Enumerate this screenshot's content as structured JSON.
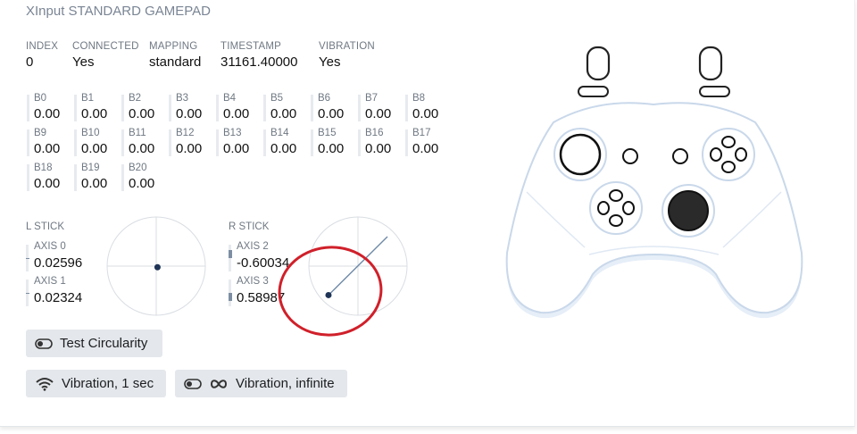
{
  "title": "XInput STANDARD GAMEPAD",
  "info": [
    {
      "label": "INDEX",
      "value": "0"
    },
    {
      "label": "CONNECTED",
      "value": "Yes"
    },
    {
      "label": "MAPPING",
      "value": "standard"
    },
    {
      "label": "TIMESTAMP",
      "value": "31161.40000"
    },
    {
      "label": "VIBRATION",
      "value": "Yes"
    }
  ],
  "buttons": [
    {
      "label": "B0",
      "value": "0.00"
    },
    {
      "label": "B1",
      "value": "0.00"
    },
    {
      "label": "B2",
      "value": "0.00"
    },
    {
      "label": "B3",
      "value": "0.00"
    },
    {
      "label": "B4",
      "value": "0.00"
    },
    {
      "label": "B5",
      "value": "0.00"
    },
    {
      "label": "B6",
      "value": "0.00"
    },
    {
      "label": "B7",
      "value": "0.00"
    },
    {
      "label": "B8",
      "value": "0.00"
    },
    {
      "label": "B9",
      "value": "0.00"
    },
    {
      "label": "B10",
      "value": "0.00"
    },
    {
      "label": "B11",
      "value": "0.00"
    },
    {
      "label": "B12",
      "value": "0.00"
    },
    {
      "label": "B13",
      "value": "0.00"
    },
    {
      "label": "B14",
      "value": "0.00"
    },
    {
      "label": "B15",
      "value": "0.00"
    },
    {
      "label": "B16",
      "value": "0.00"
    },
    {
      "label": "B17",
      "value": "0.00"
    },
    {
      "label": "B18",
      "value": "0.00"
    },
    {
      "label": "B19",
      "value": "0.00"
    },
    {
      "label": "B20",
      "value": "0.00"
    }
  ],
  "left_stick": {
    "title": "L STICK",
    "axes": [
      {
        "label": "AXIS 0",
        "value": "0.02596",
        "level": 0.02596
      },
      {
        "label": "AXIS 1",
        "value": "0.02324",
        "level": 0.02324
      }
    ]
  },
  "right_stick": {
    "title": "R STICK",
    "axes": [
      {
        "label": "AXIS 2",
        "value": "-0.60034",
        "level": -0.60034
      },
      {
        "label": "AXIS 3",
        "value": "0.58987",
        "level": 0.58987
      }
    ],
    "pointer_start": {
      "x": 0.6,
      "y": -0.6
    }
  },
  "actions": {
    "circularity": "Test Circularity",
    "vibration_1sec": "Vibration, 1 sec",
    "vibration_infinite": "Vibration, infinite"
  },
  "colors": {
    "annotation": "#d0202a",
    "accent": "#1f3557",
    "controller_outline": "#c9d8ea"
  }
}
